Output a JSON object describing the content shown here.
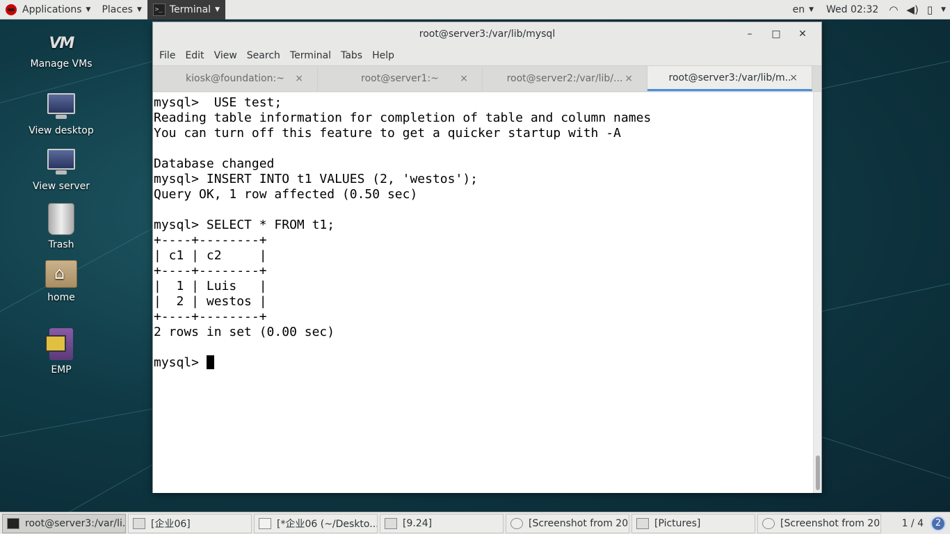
{
  "top_panel": {
    "applications": "Applications",
    "places": "Places",
    "terminal_app": "Terminal",
    "language": "en",
    "clock": "Wed 02:32"
  },
  "desktop_icons": [
    {
      "label": "Manage VMs",
      "icon": "vm-manager-icon",
      "vm_text": "VM"
    },
    {
      "label": "View desktop",
      "icon": "monitor-icon"
    },
    {
      "label": "View server",
      "icon": "monitor-icon"
    },
    {
      "label": "Trash",
      "icon": "trash-icon"
    },
    {
      "label": "home",
      "icon": "home-folder-icon"
    },
    {
      "label": "EMP",
      "icon": "emp-icon"
    }
  ],
  "window": {
    "title": "root@server3:/var/lib/mysql",
    "menu": [
      "File",
      "Edit",
      "View",
      "Search",
      "Terminal",
      "Tabs",
      "Help"
    ],
    "tabs": [
      {
        "label": "kiosk@foundation:~",
        "active": false
      },
      {
        "label": "root@server1:~",
        "active": false
      },
      {
        "label": "root@server2:/var/lib/...",
        "active": false
      },
      {
        "label": "root@server3:/var/lib/m...",
        "active": true
      }
    ],
    "close_glyph": "×",
    "terminal_lines": [
      "mysql>  USE test;",
      "Reading table information for completion of table and column names",
      "You can turn off this feature to get a quicker startup with -A",
      "",
      "Database changed",
      "mysql> INSERT INTO t1 VALUES (2, 'westos');",
      "Query OK, 1 row affected (0.50 sec)",
      "",
      "mysql> SELECT * FROM t1;",
      "+----+--------+",
      "| c1 | c2     |",
      "+----+--------+",
      "|  1 | Luis   |",
      "|  2 | westos |",
      "+----+--------+",
      "2 rows in set (0.00 sec)",
      ""
    ],
    "prompt": "mysql> "
  },
  "taskbar": {
    "tasks": [
      {
        "label": "root@server3:/var/li...",
        "icon": "terminal-icon",
        "active": true
      },
      {
        "label": "[企业06]",
        "icon": "file-manager-icon",
        "active": false
      },
      {
        "label": "[*企业06 (~/Deskto...",
        "icon": "text-editor-icon",
        "active": false
      },
      {
        "label": "[9.24]",
        "icon": "file-manager-icon",
        "active": false
      },
      {
        "label": "[Screenshot from 20...",
        "icon": "screenshot-icon",
        "active": false
      },
      {
        "label": "[Pictures]",
        "icon": "file-manager-icon",
        "active": false
      },
      {
        "label": "[Screenshot from 20...",
        "icon": "screenshot-icon",
        "active": false
      }
    ],
    "workspace": "1 / 4",
    "notifications": "2"
  }
}
